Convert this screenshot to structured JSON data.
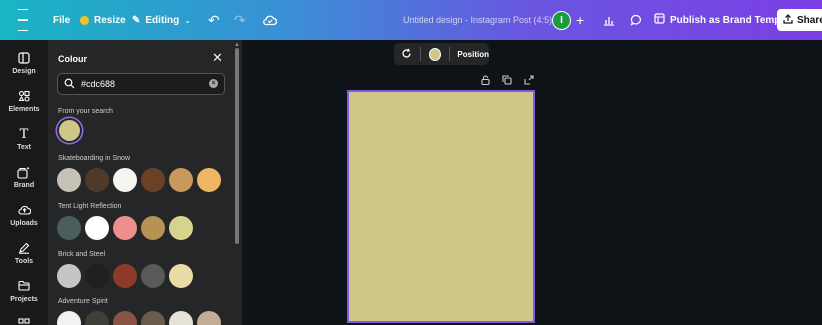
{
  "topbar": {
    "file": "File",
    "resize": "Resize",
    "editing": "Editing",
    "title": "Untitled design - Instagram Post (4:5)",
    "avatar_initial": "I",
    "publish": "Publish as Brand Template",
    "share": "Share"
  },
  "rail": {
    "design": "Design",
    "elements": "Elements",
    "text": "Text",
    "brand": "Brand",
    "uploads": "Uploads",
    "tools": "Tools",
    "projects": "Projects"
  },
  "panel": {
    "title": "Colour",
    "search_value": "#cdc688",
    "sections": [
      {
        "label": "From your search",
        "colors": [
          "#d0c688"
        ]
      },
      {
        "label": "Skateboarding in Snow",
        "colors": [
          "#c7c2b7",
          "#4e3b2c",
          "#f7f5f2",
          "#6a4127",
          "#c79a5c",
          "#efb764"
        ]
      },
      {
        "label": "Tent Light Reflection",
        "colors": [
          "#4a5e5d",
          "#ffffff",
          "#ef8e8e",
          "#b89154",
          "#d6d38e"
        ]
      },
      {
        "label": "Brick and Steel",
        "colors": [
          "#c5c5c5",
          "#202020",
          "#8e3a2a",
          "#595959",
          "#ecdba6"
        ]
      },
      {
        "label": "Adventure Spirit",
        "colors": [
          "#f2f2f2",
          "#3e3f37",
          "#8a5444",
          "#6b5d4c",
          "#e7e2d6",
          "#c4ad95"
        ]
      }
    ]
  },
  "canvas": {
    "page_color": "#d0c688",
    "position_label": "Position"
  }
}
